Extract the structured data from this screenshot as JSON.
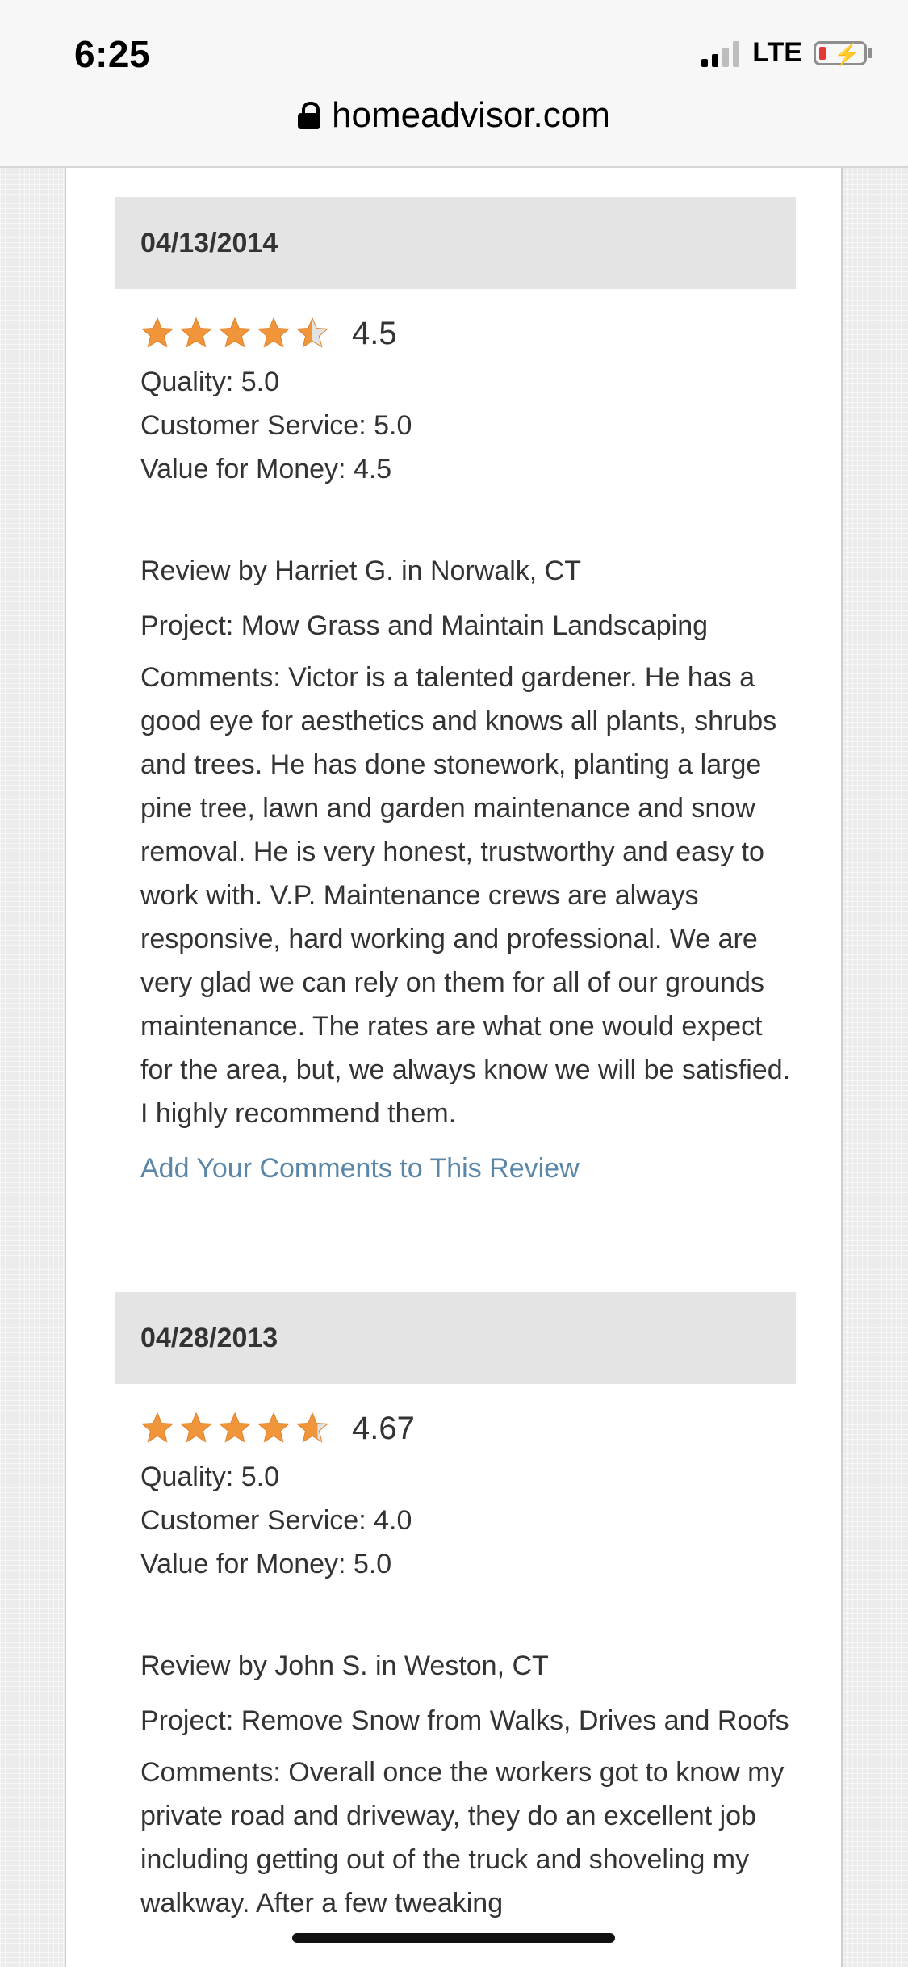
{
  "status_bar": {
    "time": "6:25",
    "network": "LTE"
  },
  "browser": {
    "url": "homeadvisor.com"
  },
  "reviews": [
    {
      "date": "04/13/2014",
      "rating": "4.5",
      "stars_filled": 4.5,
      "quality": "Quality: 5.0",
      "customer_service": "Customer Service: 5.0",
      "value_for_money": "Value for Money: 4.5",
      "reviewer": "Review by Harriet G. in Norwalk, CT",
      "project": "Project: Mow Grass and Maintain Landscaping",
      "comments": "Comments: Victor is a talented gardener. He has a good eye for aesthetics and knows all plants, shrubs and trees. He has done stonework, planting a large pine tree, lawn and garden maintenance and snow removal. He is very honest, trustworthy and easy to work with. V.P. Maintenance crews are always responsive, hard working and professional. We are very glad we can rely on them for all of our grounds maintenance. The rates are what one would expect for the area, but, we always know we will be satisfied. I highly recommend them.",
      "add_comment_link": "Add Your Comments to This Review"
    },
    {
      "date": "04/28/2013",
      "rating": "4.67",
      "stars_filled": 4.67,
      "quality": "Quality: 5.0",
      "customer_service": "Customer Service: 4.0",
      "value_for_money": "Value for Money: 5.0",
      "reviewer": "Review by John S. in Weston, CT",
      "project": "Project: Remove Snow from Walks, Drives and Roofs",
      "comments": "Comments: Overall once the workers got to know my private road and driveway, they do an excellent job including getting out of the truck and shoveling my walkway. After a few tweaking"
    }
  ],
  "colors": {
    "star": "#f0953a",
    "star_empty": "#e2e2e2",
    "link": "#5a86a8",
    "header_bg": "#e4e4e4"
  }
}
